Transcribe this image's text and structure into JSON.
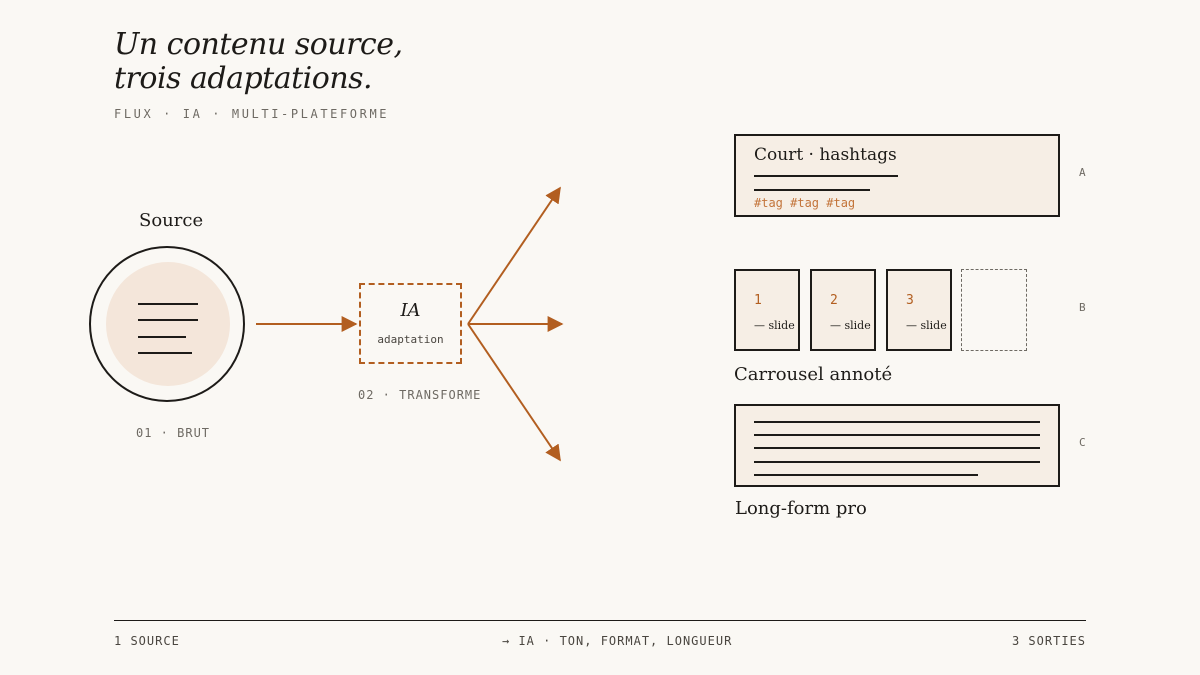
{
  "header": {
    "title_line1": "Un contenu source,",
    "title_line2": "trois adaptations.",
    "subtitle": "FLUX · IA · MULTI-PLATEFORME"
  },
  "source": {
    "label": "Source",
    "caption": "01 · BRUT"
  },
  "ia": {
    "title": "IA",
    "subtitle": "adaptation",
    "caption": "02 · TRANSFORME"
  },
  "outputs": {
    "a": {
      "letter": "A",
      "title": "Court · hashtags",
      "tags": "#tag #tag #tag"
    },
    "b": {
      "letter": "B",
      "label": "Carrousel annoté",
      "slides": [
        {
          "num": "1",
          "sub": "— slide"
        },
        {
          "num": "2",
          "sub": "— slide"
        },
        {
          "num": "3",
          "sub": "— slide"
        }
      ]
    },
    "c": {
      "letter": "C",
      "label": "Long-form pro"
    }
  },
  "footer": {
    "left": "1 SOURCE",
    "center": "→ IA · TON, FORMAT, LONGUEUR",
    "right": "3 SORTIES"
  },
  "colors": {
    "background": "#faf8f4",
    "accent": "#b25e20",
    "card_fill": "#f6eee5",
    "source_fill": "#f4e6da",
    "ink": "#1d1b18"
  }
}
